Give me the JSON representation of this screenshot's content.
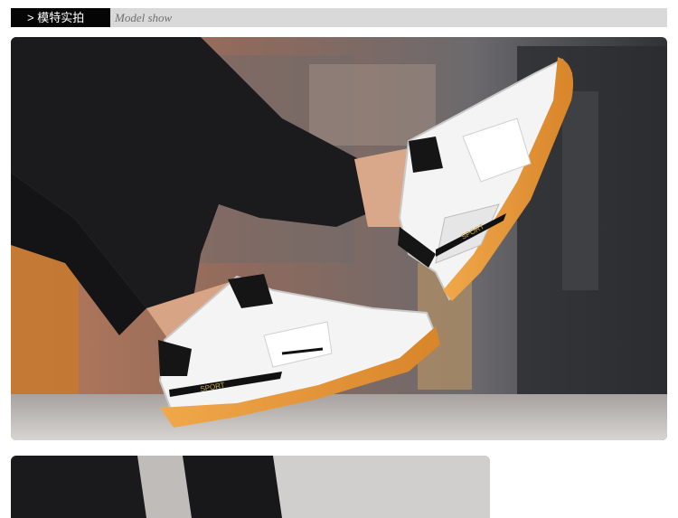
{
  "header": {
    "tag_label": "> 模特实拍",
    "subtitle": "Model show"
  },
  "photos": {
    "main": {
      "alt": "Model wearing white sport shoes with gum soles, legs raised"
    },
    "second": {
      "alt": "Model wearing sport shoes (partial view)"
    }
  },
  "shoe_text": "SPORT",
  "colors": {
    "header_black": "#050505",
    "header_gray": "#d9d9d9",
    "sole_orange": "#e79a3a",
    "pants_black": "#1b1b1d"
  }
}
